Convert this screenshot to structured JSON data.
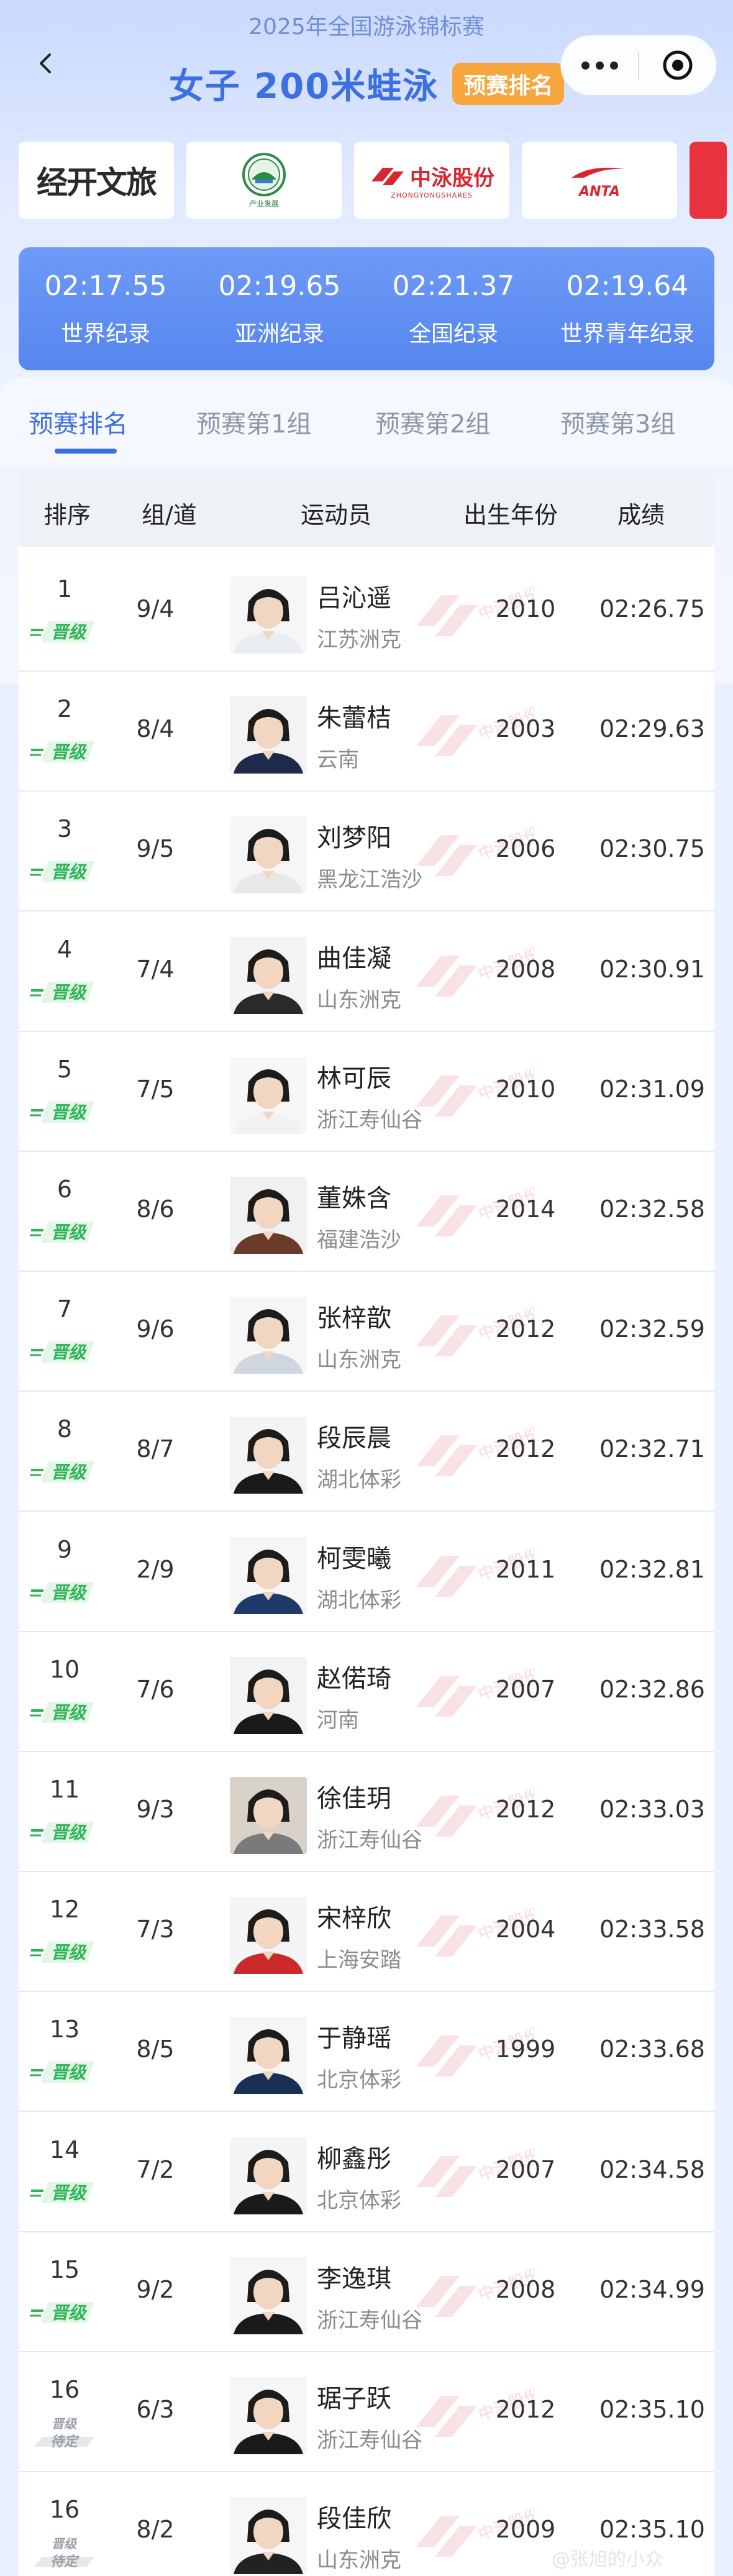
{
  "app": {
    "subtitle": "2025年全国游泳锦标赛",
    "title": "女子 200米蛙泳",
    "title_badge": "预赛排名"
  },
  "sponsors": [
    {
      "name": "经开文旅",
      "icon": "jingkai-wenlv-logo"
    },
    {
      "name": "产业发展",
      "icon": "green-emblem-logo"
    },
    {
      "name": "中泳股份",
      "sub": "ZHONGYONGSHARES",
      "icon": "zhongyong-logo"
    },
    {
      "name": "ANTA",
      "icon": "anta-logo"
    }
  ],
  "records": [
    {
      "time": "02:17.55",
      "label": "世界纪录"
    },
    {
      "time": "02:19.65",
      "label": "亚洲纪录"
    },
    {
      "time": "02:21.37",
      "label": "全国纪录"
    },
    {
      "time": "02:19.64",
      "label": "世界青年纪录"
    }
  ],
  "tabs": [
    {
      "label": "预赛排名",
      "active": true
    },
    {
      "label": "预赛第1组",
      "active": false
    },
    {
      "label": "预赛第2组",
      "active": false
    },
    {
      "label": "预赛第3组",
      "active": false
    }
  ],
  "table": {
    "headers": [
      "排序",
      "组/道",
      "运动员",
      "出生年份",
      "成绩"
    ],
    "rows": [
      {
        "rank": "1",
        "status": "晋级",
        "group_lane": "9/4",
        "name": "吕沁遥",
        "club": "江苏洲克",
        "year": "2010",
        "result": "02:26.75"
      },
      {
        "rank": "2",
        "status": "晋级",
        "group_lane": "8/4",
        "name": "朱蕾桔",
        "club": "云南",
        "year": "2003",
        "result": "02:29.63"
      },
      {
        "rank": "3",
        "status": "晋级",
        "group_lane": "9/5",
        "name": "刘梦阳",
        "club": "黑龙江浩沙",
        "year": "2006",
        "result": "02:30.75"
      },
      {
        "rank": "4",
        "status": "晋级",
        "group_lane": "7/4",
        "name": "曲佳凝",
        "club": "山东洲克",
        "year": "2008",
        "result": "02:30.91"
      },
      {
        "rank": "5",
        "status": "晋级",
        "group_lane": "7/5",
        "name": "林可辰",
        "club": "浙江寿仙谷",
        "year": "2010",
        "result": "02:31.09"
      },
      {
        "rank": "6",
        "status": "晋级",
        "group_lane": "8/6",
        "name": "董姝含",
        "club": "福建浩沙",
        "year": "2014",
        "result": "02:32.58"
      },
      {
        "rank": "7",
        "status": "晋级",
        "group_lane": "9/6",
        "name": "张梓歆",
        "club": "山东洲克",
        "year": "2012",
        "result": "02:32.59"
      },
      {
        "rank": "8",
        "status": "晋级",
        "group_lane": "8/7",
        "name": "段辰晨",
        "club": "湖北体彩",
        "year": "2012",
        "result": "02:32.71"
      },
      {
        "rank": "9",
        "status": "晋级",
        "group_lane": "2/9",
        "name": "柯雯曦",
        "club": "湖北体彩",
        "year": "2011",
        "result": "02:32.81"
      },
      {
        "rank": "10",
        "status": "晋级",
        "group_lane": "7/6",
        "name": "赵偌琦",
        "club": "河南",
        "year": "2007",
        "result": "02:32.86"
      },
      {
        "rank": "11",
        "status": "晋级",
        "group_lane": "9/3",
        "name": "徐佳玥",
        "club": "浙江寿仙谷",
        "year": "2012",
        "result": "02:33.03"
      },
      {
        "rank": "12",
        "status": "晋级",
        "group_lane": "7/3",
        "name": "宋梓欣",
        "club": "上海安踏",
        "year": "2004",
        "result": "02:33.58"
      },
      {
        "rank": "13",
        "status": "晋级",
        "group_lane": "8/5",
        "name": "于静瑶",
        "club": "北京体彩",
        "year": "1999",
        "result": "02:33.68"
      },
      {
        "rank": "14",
        "status": "晋级",
        "group_lane": "7/2",
        "name": "柳鑫彤",
        "club": "北京体彩",
        "year": "2007",
        "result": "02:34.58"
      },
      {
        "rank": "15",
        "status": "晋级",
        "group_lane": "9/2",
        "name": "李逸琪",
        "club": "浙江寿仙谷",
        "year": "2008",
        "result": "02:34.99"
      },
      {
        "rank": "16",
        "status": "晋级待定",
        "group_lane": "6/3",
        "name": "琚子跃",
        "club": "浙江寿仙谷",
        "year": "2012",
        "result": "02:35.10"
      },
      {
        "rank": "16",
        "status": "晋级待定",
        "group_lane": "8/2",
        "name": "段佳欣",
        "club": "山东洲克",
        "year": "2009",
        "result": "02:35.10"
      }
    ]
  },
  "footer_watermark": "@张旭的小众",
  "colors": {
    "accent": "#3d6fe0",
    "badge_orange": "#f7a63e",
    "qualified_green": "#2fb457",
    "pending_gray": "#9aa0a8",
    "record_bg": "#5b8cf2"
  }
}
